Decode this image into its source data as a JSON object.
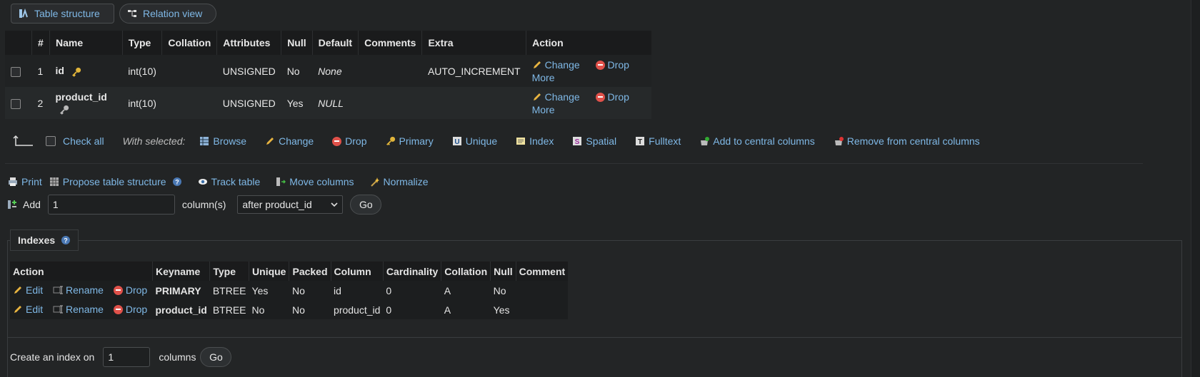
{
  "tabs": {
    "structure": "Table structure",
    "relation": "Relation view"
  },
  "structure": {
    "headers": [
      "#",
      "Name",
      "Type",
      "Collation",
      "Attributes",
      "Null",
      "Default",
      "Comments",
      "Extra",
      "Action"
    ],
    "rows": [
      {
        "num": "1",
        "name": "id",
        "type": "int(10)",
        "collation": "",
        "attributes": "UNSIGNED",
        "null": "No",
        "default": "None",
        "comments": "",
        "extra": "AUTO_INCREMENT"
      },
      {
        "num": "2",
        "name": "product_id",
        "type": "int(10)",
        "collation": "",
        "attributes": "UNSIGNED",
        "null": "Yes",
        "default": "NULL",
        "comments": "",
        "extra": ""
      }
    ],
    "actions": {
      "change": "Change",
      "drop": "Drop",
      "more": "More"
    }
  },
  "with_selected": {
    "check_all": "Check all",
    "label": "With selected:",
    "items": [
      "Browse",
      "Change",
      "Drop",
      "Primary",
      "Unique",
      "Index",
      "Spatial",
      "Fulltext",
      "Add to central columns",
      "Remove from central columns"
    ]
  },
  "tools": {
    "print": "Print",
    "propose": "Propose table structure",
    "track": "Track table",
    "move": "Move columns",
    "normalize": "Normalize"
  },
  "add_column": {
    "label": "Add",
    "value": "1",
    "unit": "column(s)",
    "position": "after product_id",
    "go": "Go"
  },
  "indexes": {
    "title": "Indexes",
    "headers": [
      "Action",
      "Keyname",
      "Type",
      "Unique",
      "Packed",
      "Column",
      "Cardinality",
      "Collation",
      "Null",
      "Comment"
    ],
    "actions": {
      "edit": "Edit",
      "rename": "Rename",
      "drop": "Drop"
    },
    "rows": [
      {
        "keyname": "PRIMARY",
        "type": "BTREE",
        "unique": "Yes",
        "packed": "No",
        "column": "id",
        "cardinality": "0",
        "collation": "A",
        "null": "No",
        "comment": ""
      },
      {
        "keyname": "product_id",
        "type": "BTREE",
        "unique": "No",
        "packed": "No",
        "column": "product_id",
        "cardinality": "0",
        "collation": "A",
        "null": "Yes",
        "comment": ""
      }
    ],
    "create_label": "Create an index on",
    "create_value": "1",
    "create_unit": "columns",
    "go": "Go"
  },
  "colors": {
    "link": "#7fb8e6",
    "drop": "#e0514a",
    "background": "#222425",
    "header": "#1a1b1c"
  }
}
